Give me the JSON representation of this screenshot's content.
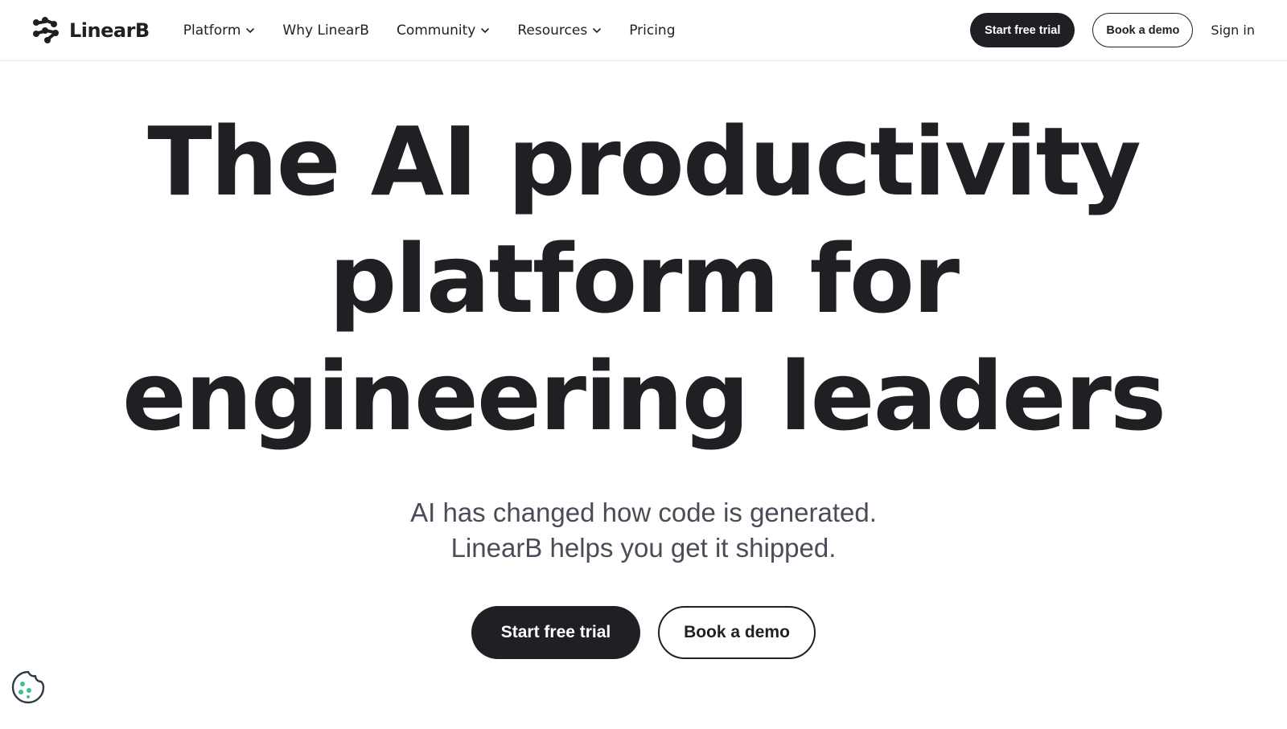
{
  "brand": {
    "name": "LinearB"
  },
  "nav": {
    "items": [
      {
        "label": "Platform",
        "has_dropdown": true
      },
      {
        "label": "Why LinearB",
        "has_dropdown": false
      },
      {
        "label": "Community",
        "has_dropdown": true
      },
      {
        "label": "Resources",
        "has_dropdown": true
      },
      {
        "label": "Pricing",
        "has_dropdown": false
      }
    ]
  },
  "header_actions": {
    "trial_label": "Start free trial",
    "demo_label": "Book a demo",
    "signin_label": "Sign in"
  },
  "hero": {
    "title_lines": [
      "The AI productivity",
      "platform for",
      "engineering leaders"
    ],
    "subtitle_lines": [
      "AI has changed how code is generated.",
      "LinearB helps you get it shipped."
    ],
    "cta_primary": "Start free trial",
    "cta_secondary": "Book a demo"
  },
  "colors": {
    "text": "#1f2023",
    "subtitle": "#4a4d57",
    "cookie_accent": "#3fbf8f"
  },
  "icons": {
    "logo": "linearb-logo-mark",
    "dropdown": "chevron-down-icon",
    "cookie": "cookie-icon"
  }
}
